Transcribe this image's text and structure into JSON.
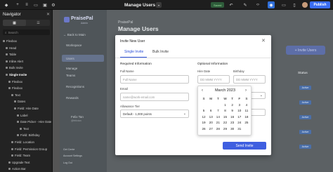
{
  "topbar": {
    "page_title": "Manage Users",
    "page_badge": "▾",
    "saved_label": "Saved",
    "publish_label": "Publish"
  },
  "navigator": {
    "title": "Navigator",
    "close": "✕",
    "search_placeholder": "Search",
    "tree": [
      {
        "label": "Flexbox",
        "indent": 0
      },
      {
        "label": "Head",
        "indent": 1
      },
      {
        "label": "Table",
        "indent": 1
      },
      {
        "label": "Inline Alert",
        "indent": 1
      },
      {
        "label": "Bulk Invite",
        "indent": 1
      },
      {
        "label": "Single Invite",
        "indent": 1,
        "selected": true
      },
      {
        "label": "Flexbox",
        "indent": 2
      },
      {
        "label": "Flexbox",
        "indent": 2
      },
      {
        "label": "Text",
        "indent": 3
      },
      {
        "label": "Dates",
        "indent": 4
      },
      {
        "label": "Field: Hire Date",
        "indent": 4
      },
      {
        "label": "Label",
        "indent": 5
      },
      {
        "label": "Date Picker - Hire Date",
        "indent": 5
      },
      {
        "label": "Text",
        "indent": 6
      },
      {
        "label": "Field: Birthday",
        "indent": 5
      },
      {
        "label": "Field: Location",
        "indent": 3
      },
      {
        "label": "Field: Permission Group",
        "indent": 3
      },
      {
        "label": "Field: Team",
        "indent": 3
      },
      {
        "label": "Upgrade Text",
        "indent": 2
      },
      {
        "label": "Action Bar",
        "indent": 2
      }
    ]
  },
  "app": {
    "logo_text": "PraisePal",
    "logo_sub": "Admin",
    "back_link": "Back to Main",
    "sidebar": [
      "Workspace",
      "Users",
      "Manage",
      "Teams",
      "Recognitions",
      "Rewards"
    ],
    "user_name": "Felix Tan",
    "user_role": "@felixtan",
    "user_links": [
      "Get Cente",
      "Account Settings",
      "Log Out"
    ],
    "breadcrumb": "PraisePal",
    "title": "Manage Users",
    "invite_button": "Invite Users",
    "status_header": "Status",
    "status_pills": [
      "Active",
      "Active",
      "Active",
      "Active",
      "Active"
    ]
  },
  "modal": {
    "title": "Invite New User",
    "close": "✕",
    "tabs": [
      "Single Invite",
      "Bulk Invite"
    ],
    "required_section": "Required Information",
    "optional_section": "Optional Information",
    "full_name_label": "Full Name",
    "full_name_placeholder": "Full Name",
    "email_label": "Email",
    "email_placeholder": "name@work-email.com",
    "allowance_label": "Allowance Tier",
    "allowance_value": "Default - 1,000 points",
    "hire_date_label": "Hire Date",
    "hire_date_placeholder": "DD MMM YYYY",
    "birthday_label": "Birthday",
    "birthday_placeholder": "DD MMM YYYY",
    "submit_label": "Send Invite"
  },
  "calendar": {
    "month": "March 2023",
    "prev": "‹",
    "next": "›",
    "weekdays": [
      "S",
      "M",
      "T",
      "W",
      "T",
      "F",
      "S"
    ],
    "days": [
      "",
      "",
      "",
      "1",
      "2",
      "3",
      "4",
      "5",
      "6",
      "7",
      "8",
      "9",
      "10",
      "11",
      "12",
      "13",
      "14",
      "15",
      "16",
      "17",
      "18",
      "19",
      "20",
      "21",
      "22",
      "23",
      "24",
      "25",
      "26",
      "27",
      "28",
      "29",
      "30",
      "31",
      ""
    ]
  },
  "colors": {
    "accent": "#2a4fd8",
    "publish": "#3b6ef5"
  }
}
